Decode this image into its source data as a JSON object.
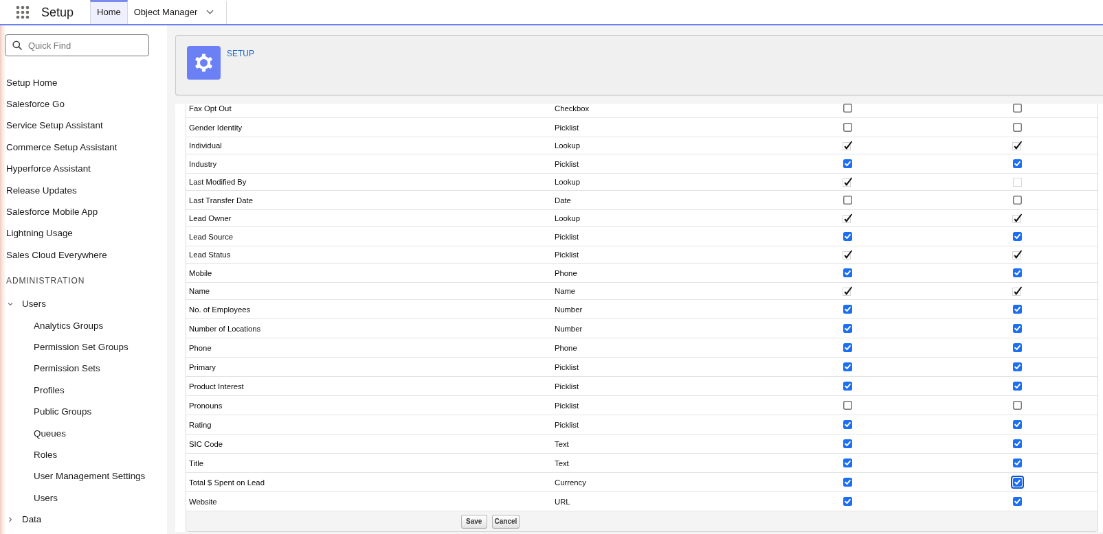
{
  "app_bar": {
    "title": "Setup",
    "tabs": [
      {
        "label": "Home",
        "selected": true,
        "dropdown": false
      },
      {
        "label": "Object Manager",
        "selected": false,
        "dropdown": true
      }
    ]
  },
  "sidebar": {
    "search": {
      "placeholder": "Quick Find"
    },
    "items": [
      {
        "kind": "link",
        "label": "Setup Home",
        "selected": false
      },
      {
        "kind": "link",
        "label": "Salesforce Go",
        "selected": false
      },
      {
        "kind": "link",
        "label": "Service Setup Assistant",
        "selected": false
      },
      {
        "kind": "link",
        "label": "Commerce Setup Assistant",
        "selected": false
      },
      {
        "kind": "link",
        "label": "Hyperforce Assistant",
        "selected": false
      },
      {
        "kind": "link",
        "label": "Release Updates",
        "selected": false
      },
      {
        "kind": "link",
        "label": "Salesforce Mobile App",
        "selected": false
      },
      {
        "kind": "link",
        "label": "Lightning Usage",
        "selected": false
      },
      {
        "kind": "link",
        "label": "Sales Cloud Everywhere",
        "selected": false
      },
      {
        "kind": "heading",
        "label": "ADMINISTRATION"
      },
      {
        "kind": "group",
        "label": "Users",
        "expanded": true,
        "children": [
          {
            "label": "Analytics Groups",
            "selected": false
          },
          {
            "label": "Permission Set Groups",
            "selected": false
          },
          {
            "label": "Permission Sets",
            "selected": false
          },
          {
            "label": "Profiles",
            "selected": false
          },
          {
            "label": "Public Groups",
            "selected": false
          },
          {
            "label": "Queues",
            "selected": false
          },
          {
            "label": "Roles",
            "selected": false
          },
          {
            "label": "User Management Settings",
            "selected": false
          },
          {
            "label": "Users",
            "selected": false
          }
        ]
      },
      {
        "kind": "group",
        "label": "Data",
        "expanded": false
      }
    ]
  },
  "page_header": {
    "breadcrumb": "SETUP"
  },
  "table": {
    "rows": [
      {
        "column_1": "Fax Opt Out",
        "column_2": "Checkbox",
        "column_3": {
          "kind": "checkbox",
          "checked": false,
          "focused": false
        },
        "column_4": {
          "kind": "checkbox",
          "checked": false,
          "focused": false
        }
      },
      {
        "column_1": "Gender Identity",
        "column_2": "Picklist",
        "column_3": {
          "kind": "checkbox",
          "checked": false,
          "focused": false
        },
        "column_4": {
          "kind": "checkbox",
          "checked": false,
          "focused": false
        }
      },
      {
        "column_1": "Individual",
        "column_2": "Lookup",
        "column_3": {
          "kind": "readonly",
          "checked": true,
          "focused": false
        },
        "column_4": {
          "kind": "readonly",
          "checked": true,
          "focused": false
        }
      },
      {
        "column_1": "Industry",
        "column_2": "Picklist",
        "column_3": {
          "kind": "checkbox",
          "checked": true,
          "focused": false
        },
        "column_4": {
          "kind": "checkbox",
          "checked": true,
          "focused": false
        }
      },
      {
        "column_1": "Last Modified By",
        "column_2": "Lookup",
        "column_3": {
          "kind": "readonly",
          "checked": true,
          "focused": false
        },
        "column_4": {
          "kind": "readonly",
          "checked": false,
          "focused": false
        }
      },
      {
        "column_1": "Last Transfer Date",
        "column_2": "Date",
        "column_3": {
          "kind": "checkbox",
          "checked": false,
          "focused": false
        },
        "column_4": {
          "kind": "checkbox",
          "checked": false,
          "focused": false
        }
      },
      {
        "column_1": "Lead Owner",
        "column_2": "Lookup",
        "column_3": {
          "kind": "readonly",
          "checked": true,
          "focused": false
        },
        "column_4": {
          "kind": "readonly",
          "checked": true,
          "focused": false
        }
      },
      {
        "column_1": "Lead Source",
        "column_2": "Picklist",
        "column_3": {
          "kind": "checkbox",
          "checked": true,
          "focused": false
        },
        "column_4": {
          "kind": "checkbox",
          "checked": true,
          "focused": false
        }
      },
      {
        "column_1": "Lead Status",
        "column_2": "Picklist",
        "column_3": {
          "kind": "readonly",
          "checked": true,
          "focused": false
        },
        "column_4": {
          "kind": "readonly",
          "checked": true,
          "focused": false
        }
      },
      {
        "column_1": "Mobile",
        "column_2": "Phone",
        "column_3": {
          "kind": "checkbox",
          "checked": true,
          "focused": false
        },
        "column_4": {
          "kind": "checkbox",
          "checked": true,
          "focused": false
        }
      },
      {
        "column_1": "Name",
        "column_2": "Name",
        "column_3": {
          "kind": "readonly",
          "checked": true,
          "focused": false
        },
        "column_4": {
          "kind": "readonly",
          "checked": true,
          "focused": false
        }
      },
      {
        "column_1": "No. of Employees",
        "column_2": "Number",
        "column_3": {
          "kind": "checkbox",
          "checked": true,
          "focused": false
        },
        "column_4": {
          "kind": "checkbox",
          "checked": true,
          "focused": false
        }
      },
      {
        "column_1": "Number of Locations",
        "column_2": "Number",
        "column_3": {
          "kind": "checkbox",
          "checked": true,
          "focused": false
        },
        "column_4": {
          "kind": "checkbox",
          "checked": true,
          "focused": false
        }
      },
      {
        "column_1": "Phone",
        "column_2": "Phone",
        "column_3": {
          "kind": "checkbox",
          "checked": true,
          "focused": false
        },
        "column_4": {
          "kind": "checkbox",
          "checked": true,
          "focused": false
        }
      },
      {
        "column_1": "Primary",
        "column_2": "Picklist",
        "column_3": {
          "kind": "checkbox",
          "checked": true,
          "focused": false
        },
        "column_4": {
          "kind": "checkbox",
          "checked": true,
          "focused": false
        }
      },
      {
        "column_1": "Product Interest",
        "column_2": "Picklist",
        "column_3": {
          "kind": "checkbox",
          "checked": true,
          "focused": false
        },
        "column_4": {
          "kind": "checkbox",
          "checked": true,
          "focused": false
        }
      },
      {
        "column_1": "Pronouns",
        "column_2": "Picklist",
        "column_3": {
          "kind": "checkbox",
          "checked": false,
          "focused": false
        },
        "column_4": {
          "kind": "checkbox",
          "checked": false,
          "focused": false
        }
      },
      {
        "column_1": "Rating",
        "column_2": "Picklist",
        "column_3": {
          "kind": "checkbox",
          "checked": true,
          "focused": false
        },
        "column_4": {
          "kind": "checkbox",
          "checked": true,
          "focused": false
        }
      },
      {
        "column_1": "SIC Code",
        "column_2": "Text",
        "column_3": {
          "kind": "checkbox",
          "checked": true,
          "focused": false
        },
        "column_4": {
          "kind": "checkbox",
          "checked": true,
          "focused": false
        }
      },
      {
        "column_1": "Title",
        "column_2": "Text",
        "column_3": {
          "kind": "checkbox",
          "checked": true,
          "focused": false
        },
        "column_4": {
          "kind": "checkbox",
          "checked": true,
          "focused": false
        }
      },
      {
        "column_1": "Total $ Spent on Lead",
        "column_2": "Currency",
        "column_3": {
          "kind": "checkbox",
          "checked": true,
          "focused": false
        },
        "column_4": {
          "kind": "checkbox",
          "checked": true,
          "focused": true
        }
      },
      {
        "column_1": "Website",
        "column_2": "URL",
        "column_3": {
          "kind": "checkbox",
          "checked": true,
          "focused": false
        },
        "column_4": {
          "kind": "checkbox",
          "checked": true,
          "focused": false
        }
      }
    ],
    "buttons": [
      "Save",
      "Cancel"
    ]
  }
}
